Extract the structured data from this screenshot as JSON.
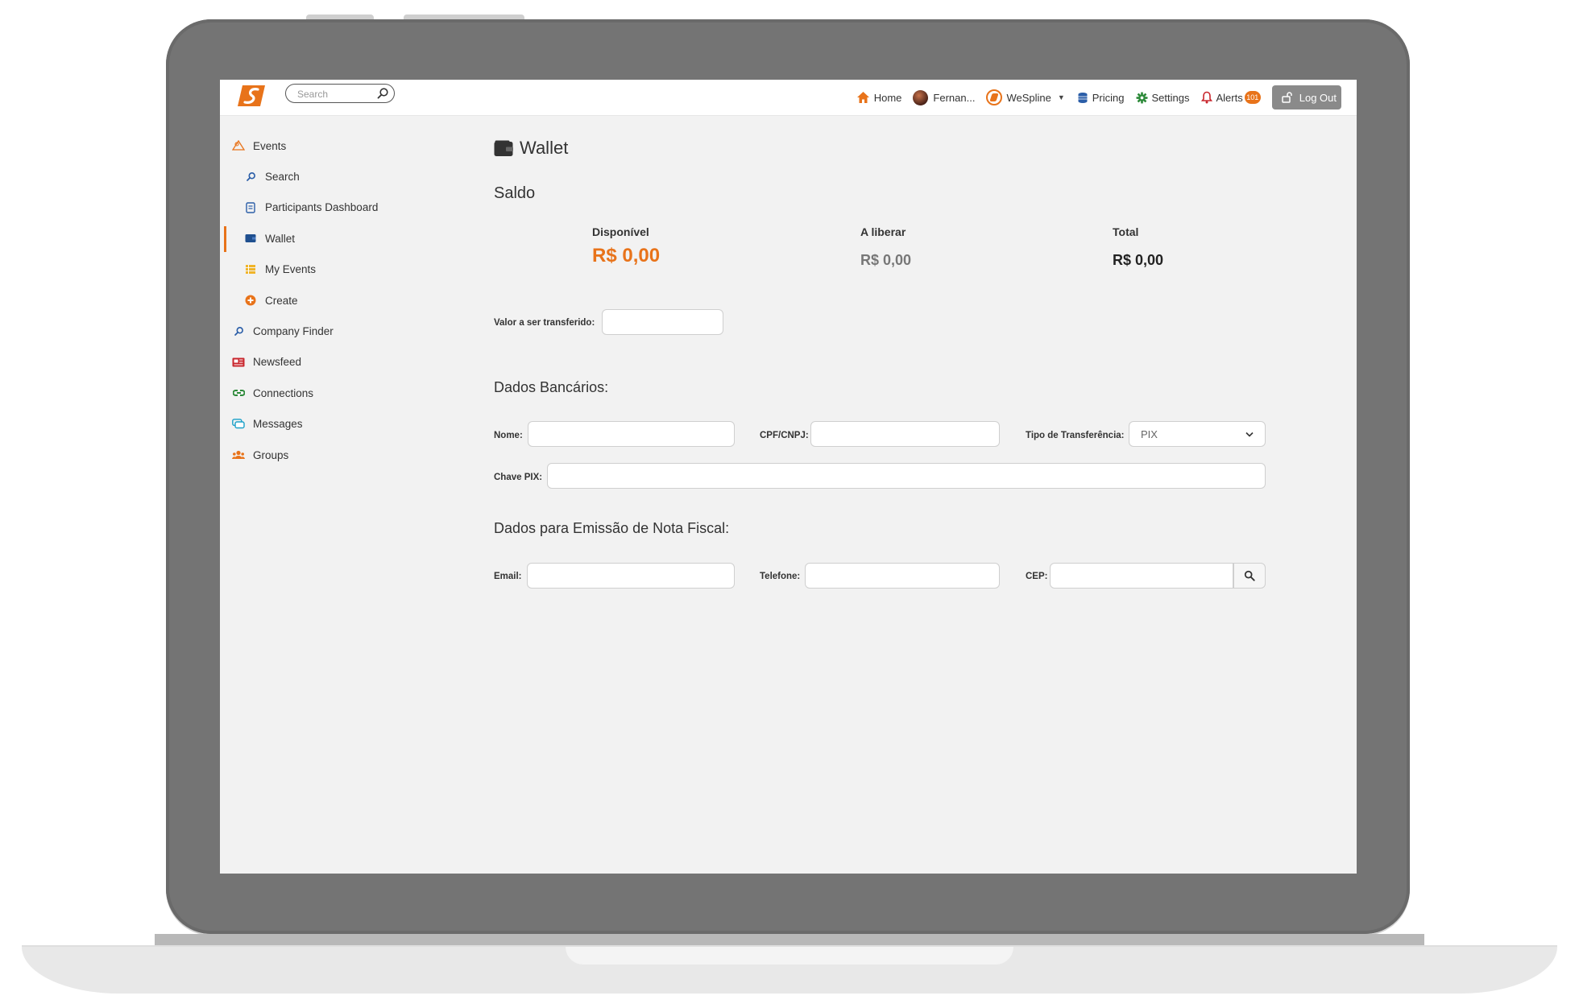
{
  "topbar": {
    "search": {
      "placeholder": "Search"
    },
    "nav": {
      "home": "Home",
      "user": "Fernan...",
      "company": "WeSpline",
      "pricing": "Pricing",
      "settings": "Settings",
      "alerts": "Alerts",
      "alerts_count": "101",
      "logout": "Log Out"
    }
  },
  "sidebar": {
    "items": [
      {
        "label": "Events",
        "icon": "events-icon"
      },
      {
        "label": "Search",
        "icon": "search-icon"
      },
      {
        "label": "Participants Dashboard",
        "icon": "document-icon"
      },
      {
        "label": "Wallet",
        "icon": "wallet-icon",
        "active": true
      },
      {
        "label": "My Events",
        "icon": "list-icon"
      },
      {
        "label": "Create",
        "icon": "plus-circle-icon"
      },
      {
        "label": "Company Finder",
        "icon": "search-icon"
      },
      {
        "label": "Newsfeed",
        "icon": "newspaper-icon"
      },
      {
        "label": "Connections",
        "icon": "link-icon"
      },
      {
        "label": "Messages",
        "icon": "chat-icon"
      },
      {
        "label": "Groups",
        "icon": "users-icon"
      }
    ]
  },
  "main": {
    "title": "Wallet",
    "saldo": {
      "heading": "Saldo",
      "disponivel_label": "Disponível",
      "disponivel_value": "R$ 0,00",
      "a_liberar_label": "A liberar",
      "a_liberar_value": "R$ 0,00",
      "total_label": "Total",
      "total_value": "R$ 0,00"
    },
    "transfer_label": "Valor a ser transferido:",
    "bank": {
      "heading": "Dados Bancários:",
      "nome_label": "Nome:",
      "cpf_label": "CPF/CNPJ:",
      "tipo_label": "Tipo de Transferência:",
      "tipo_value": "PIX",
      "chave_label": "Chave PIX:"
    },
    "nota": {
      "heading": "Dados para Emissão de Nota Fiscal:",
      "email_label": "Email:",
      "telefone_label": "Telefone:",
      "cep_label": "CEP:"
    }
  },
  "colors": {
    "accent": "#e8731a",
    "muted_value": "#777777",
    "frame": "#747474"
  }
}
